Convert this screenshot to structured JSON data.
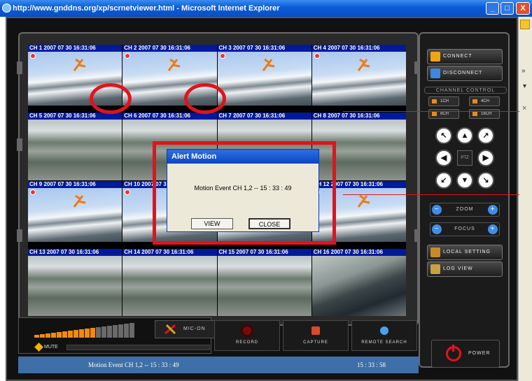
{
  "window": {
    "title": "http://www.gnddns.org/xp/scrnetviewer.html - Microsoft Internet Explorer",
    "minimize": "_",
    "maximize": "□",
    "close": "X"
  },
  "browser_strip": {
    "arrow1": "»",
    "arrow2": "▾",
    "close": "×"
  },
  "cameras": [
    {
      "label": "CH 1 2007 07 30 16:31:06"
    },
    {
      "label": "CH 2 2007 07 30 16:31:06"
    },
    {
      "label": "CH 3 2007 07 30 16:31:06"
    },
    {
      "label": "CH 4 2007 07 30 16:31:06"
    },
    {
      "label": "CH 5 2007 07 30 16:31:06"
    },
    {
      "label": "CH 6 2007 07 30 16:31:06"
    },
    {
      "label": "CH 7 2007 07 30 16:31:06"
    },
    {
      "label": "CH 8 2007 07 30 16:31:06"
    },
    {
      "label": "CH 9 2007 07 30 16:31:06"
    },
    {
      "label": "CH 10 2007 07 30 16:31:06"
    },
    {
      "label": "CH 11 2007 07 30 16:31:06"
    },
    {
      "label": "CH 12 2007 07 30 16:31:06"
    },
    {
      "label": "CH 13 2007 07 30 16:31:06"
    },
    {
      "label": "CH 14 2007 07 30 16:31:06"
    },
    {
      "label": "CH 15 2007 07 30 16:31:06"
    },
    {
      "label": "CH 16 2007 07 30 16:31:06"
    }
  ],
  "dialog": {
    "title": "Alert Motion",
    "message": "Motion Event CH 1,2 -- 15 : 33 : 49",
    "view": "VIEW",
    "close": "CLOSE"
  },
  "controls": {
    "connect": "CONNECT",
    "disconnect": "DISCONNECT",
    "channel_control": "CHANNEL CONTROL",
    "ch1": "1CH",
    "ch4": "4CH",
    "ch8": "8CH",
    "ch16": "16CH",
    "ptz": "PTZ",
    "zoom": "ZOOM",
    "focus": "FOCUS",
    "local_setting": "LOCAL SETTING",
    "log_view": "LOG VIEW",
    "power": "POWER"
  },
  "bottom": {
    "mute": "MUTE",
    "mic_on": "MIC-ON",
    "record": "RECORD",
    "capture": "CAPTURE",
    "remote_search": "REMOTE SEARCH"
  },
  "status": {
    "message": "Motion Event CH 1,2 -- 15 : 33 : 49",
    "time": "15 : 33 : 58"
  },
  "volume_level": 0.6
}
